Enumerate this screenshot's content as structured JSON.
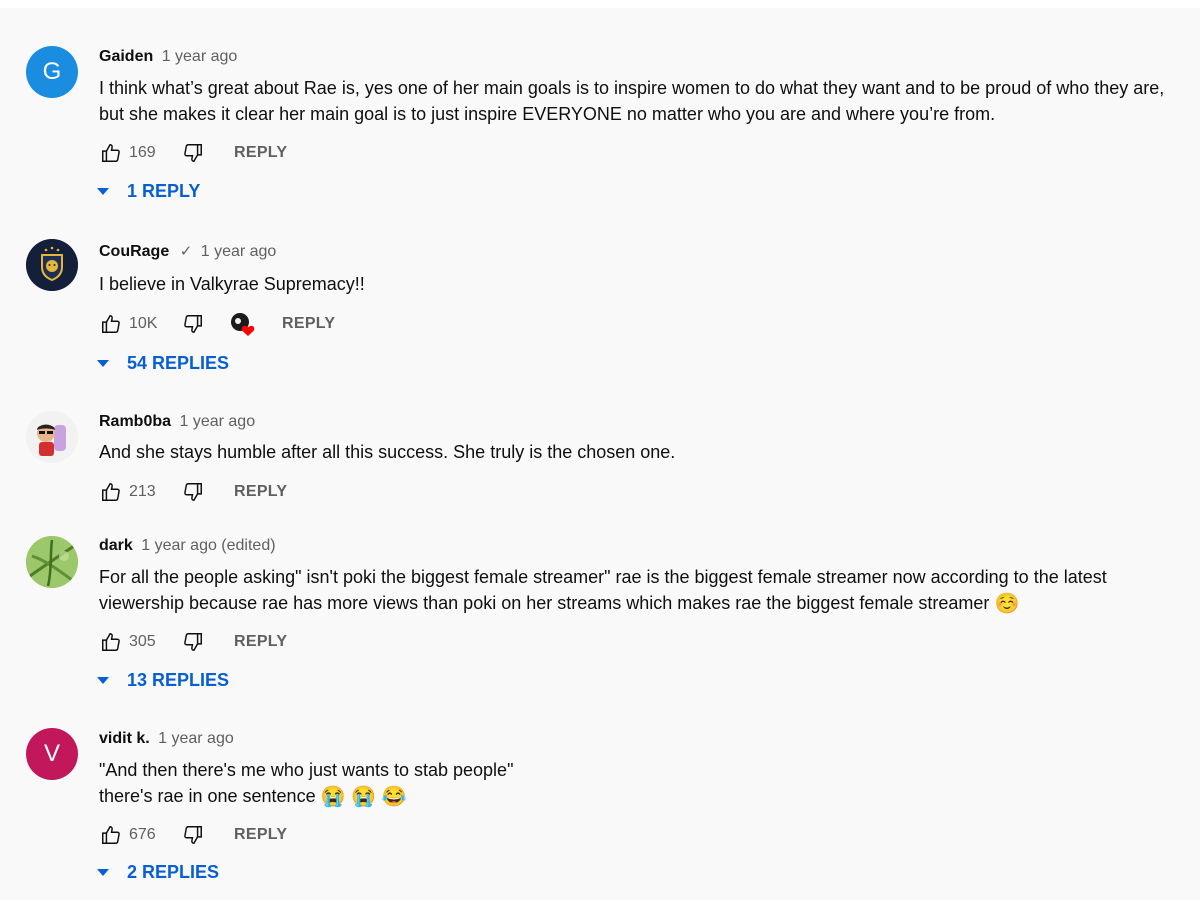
{
  "colors": {
    "link": "#065fd4",
    "meta": "#606060"
  },
  "comments": [
    {
      "avatar_letter": "G",
      "avatar_color": "#1a8de0",
      "author": "Gaiden",
      "time": "1 year ago",
      "lines": [
        "I think what’s great about Rae is, yes one of her main goals is to inspire women to do what they want and to be proud of who they are,",
        "but she makes it clear her main goal is to just inspire EVERYONE no matter who you are and where you’re from."
      ],
      "likes": "169",
      "reply_label": "REPLY",
      "replies_label": "1 REPLY"
    },
    {
      "avatar_icon": "lion-shield-icon",
      "author": "CouRage",
      "verified": "✓",
      "time": "1 year ago",
      "lines": [
        "I believe in Valkyrae Supremacy!!"
      ],
      "likes": "10K",
      "reply_label": "REPLY",
      "replies_label": "54 REPLIES"
    },
    {
      "avatar_icon": "cartoon-person-icon",
      "author": "Ramb0ba",
      "time": "1 year ago",
      "lines": [
        "And she stays humble after all this success. She truly is the chosen one."
      ],
      "likes": "213",
      "reply_label": "REPLY"
    },
    {
      "avatar_icon": "plant-photo-icon",
      "author": "dark",
      "time": "1 year ago (edited)",
      "lines": [
        "For all the people asking\" isn't poki the biggest female streamer\"  rae is the biggest female streamer now according to the latest",
        "viewership because rae has more views than poki on her streams which makes rae the biggest female streamer"
      ],
      "line_emoji": "☺️",
      "likes": "305",
      "reply_label": "REPLY",
      "replies_label": "13 REPLIES"
    },
    {
      "avatar_letter": "V",
      "avatar_color": "#c2185b",
      "author": "vidit k.",
      "time": "1 year ago",
      "lines": [
        "\"And then there's me who just wants to stab people\"",
        "there's rae in one sentence"
      ],
      "line_emoji": "😭 😭 😂",
      "likes": "676",
      "reply_label": "REPLY",
      "replies_label": "2 REPLIES"
    }
  ]
}
